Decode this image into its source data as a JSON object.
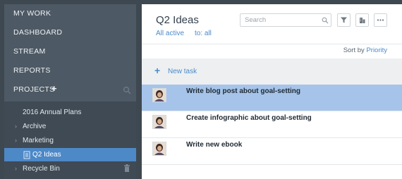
{
  "sidebar": {
    "nav": [
      "MY WORK",
      "DASHBOARD",
      "STREAM",
      "REPORTS"
    ],
    "projects_label": "PROJECTS",
    "tree": [
      {
        "label": "2016 Annual Plans",
        "chevron": false,
        "icon": null
      },
      {
        "label": "Archive",
        "chevron": true,
        "icon": null
      },
      {
        "label": "Marketing",
        "chevron": true,
        "icon": null
      },
      {
        "label": "Q2 Ideas",
        "chevron": false,
        "icon": "folder-icon",
        "active": true
      },
      {
        "label": "Recycle Bin",
        "chevron": true,
        "icon": "trash-icon"
      }
    ]
  },
  "main": {
    "title": "Q2 Ideas",
    "filter_active": "All active",
    "filter_to": "to: all",
    "search_placeholder": "Search",
    "sort_prefix": "Sort by",
    "sort_value": "Priority",
    "new_task_label": "New task",
    "tasks": [
      {
        "title": "Write blog post about goal-setting",
        "selected": true
      },
      {
        "title": "Create infographic about goal-setting",
        "selected": false
      },
      {
        "title": "Write new ebook",
        "selected": false
      }
    ]
  },
  "colors": {
    "sidebar_bg": "#4d5964",
    "active_item": "#4d88c7",
    "selected_row": "#a6c4ea",
    "link": "#4b8bc9"
  }
}
